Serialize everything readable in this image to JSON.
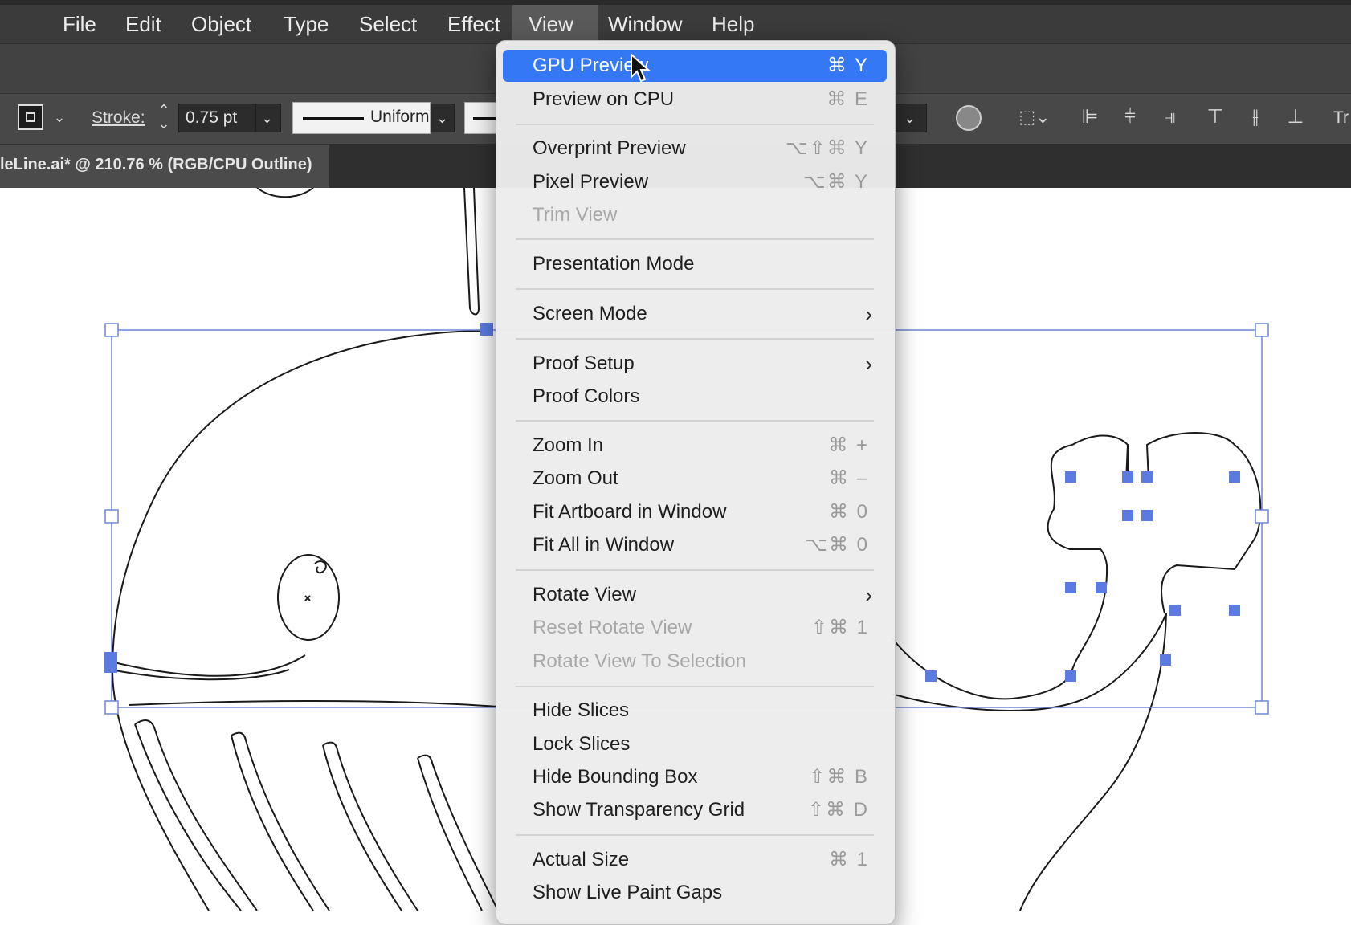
{
  "menubar": {
    "items": [
      "File",
      "Edit",
      "Object",
      "Type",
      "Select",
      "Effect",
      "View",
      "Window",
      "Help"
    ],
    "active": "View"
  },
  "control_bar": {
    "stroke_label": "Stroke:",
    "stroke_value": "0.75 pt",
    "profile_label": "Uniform",
    "right_clip_label": "Tr"
  },
  "document_tab": {
    "title": "leLine.ai* @ 210.76 % (RGB/CPU Outline)"
  },
  "view_menu": {
    "items": [
      {
        "label": "GPU Preview",
        "shortcut": "⌘ Y",
        "state": "highlighted"
      },
      {
        "label": "Preview on CPU",
        "shortcut": "⌘ E",
        "state": "enabled"
      },
      {
        "label": "Overprint Preview",
        "shortcut": "⌥⇧⌘ Y",
        "state": "enabled"
      },
      {
        "label": "Pixel Preview",
        "shortcut": "⌥⌘ Y",
        "state": "enabled"
      },
      {
        "label": "Trim View",
        "shortcut": "",
        "state": "disabled"
      },
      {
        "label": "Presentation Mode",
        "shortcut": "",
        "state": "enabled"
      },
      {
        "label": "Screen Mode",
        "shortcut": "",
        "state": "submenu"
      },
      {
        "label": "Proof Setup",
        "shortcut": "",
        "state": "submenu"
      },
      {
        "label": "Proof Colors",
        "shortcut": "",
        "state": "enabled"
      },
      {
        "label": "Zoom In",
        "shortcut": "⌘ +",
        "state": "enabled"
      },
      {
        "label": "Zoom Out",
        "shortcut": "⌘ –",
        "state": "enabled"
      },
      {
        "label": "Fit Artboard in Window",
        "shortcut": "⌘ 0",
        "state": "enabled"
      },
      {
        "label": "Fit All in Window",
        "shortcut": "⌥⌘ 0",
        "state": "enabled"
      },
      {
        "label": "Rotate View",
        "shortcut": "",
        "state": "submenu"
      },
      {
        "label": "Reset Rotate View",
        "shortcut": "⇧⌘ 1",
        "state": "disabled"
      },
      {
        "label": "Rotate View To Selection",
        "shortcut": "",
        "state": "disabled"
      },
      {
        "label": "Hide Slices",
        "shortcut": "",
        "state": "enabled"
      },
      {
        "label": "Lock Slices",
        "shortcut": "",
        "state": "enabled"
      },
      {
        "label": "Hide Bounding Box",
        "shortcut": "⇧⌘ B",
        "state": "enabled"
      },
      {
        "label": "Show Transparency Grid",
        "shortcut": "⇧⌘ D",
        "state": "enabled"
      },
      {
        "label": "Actual Size",
        "shortcut": "⌘ 1",
        "state": "enabled"
      },
      {
        "label": "Show Live Paint Gaps",
        "shortcut": "",
        "state": "enabled"
      }
    ],
    "submenu_arrow": "›"
  },
  "colors": {
    "highlight": "#3478f6",
    "selection": "#5b7be0",
    "menubar_bg": "#3b3b3b"
  }
}
